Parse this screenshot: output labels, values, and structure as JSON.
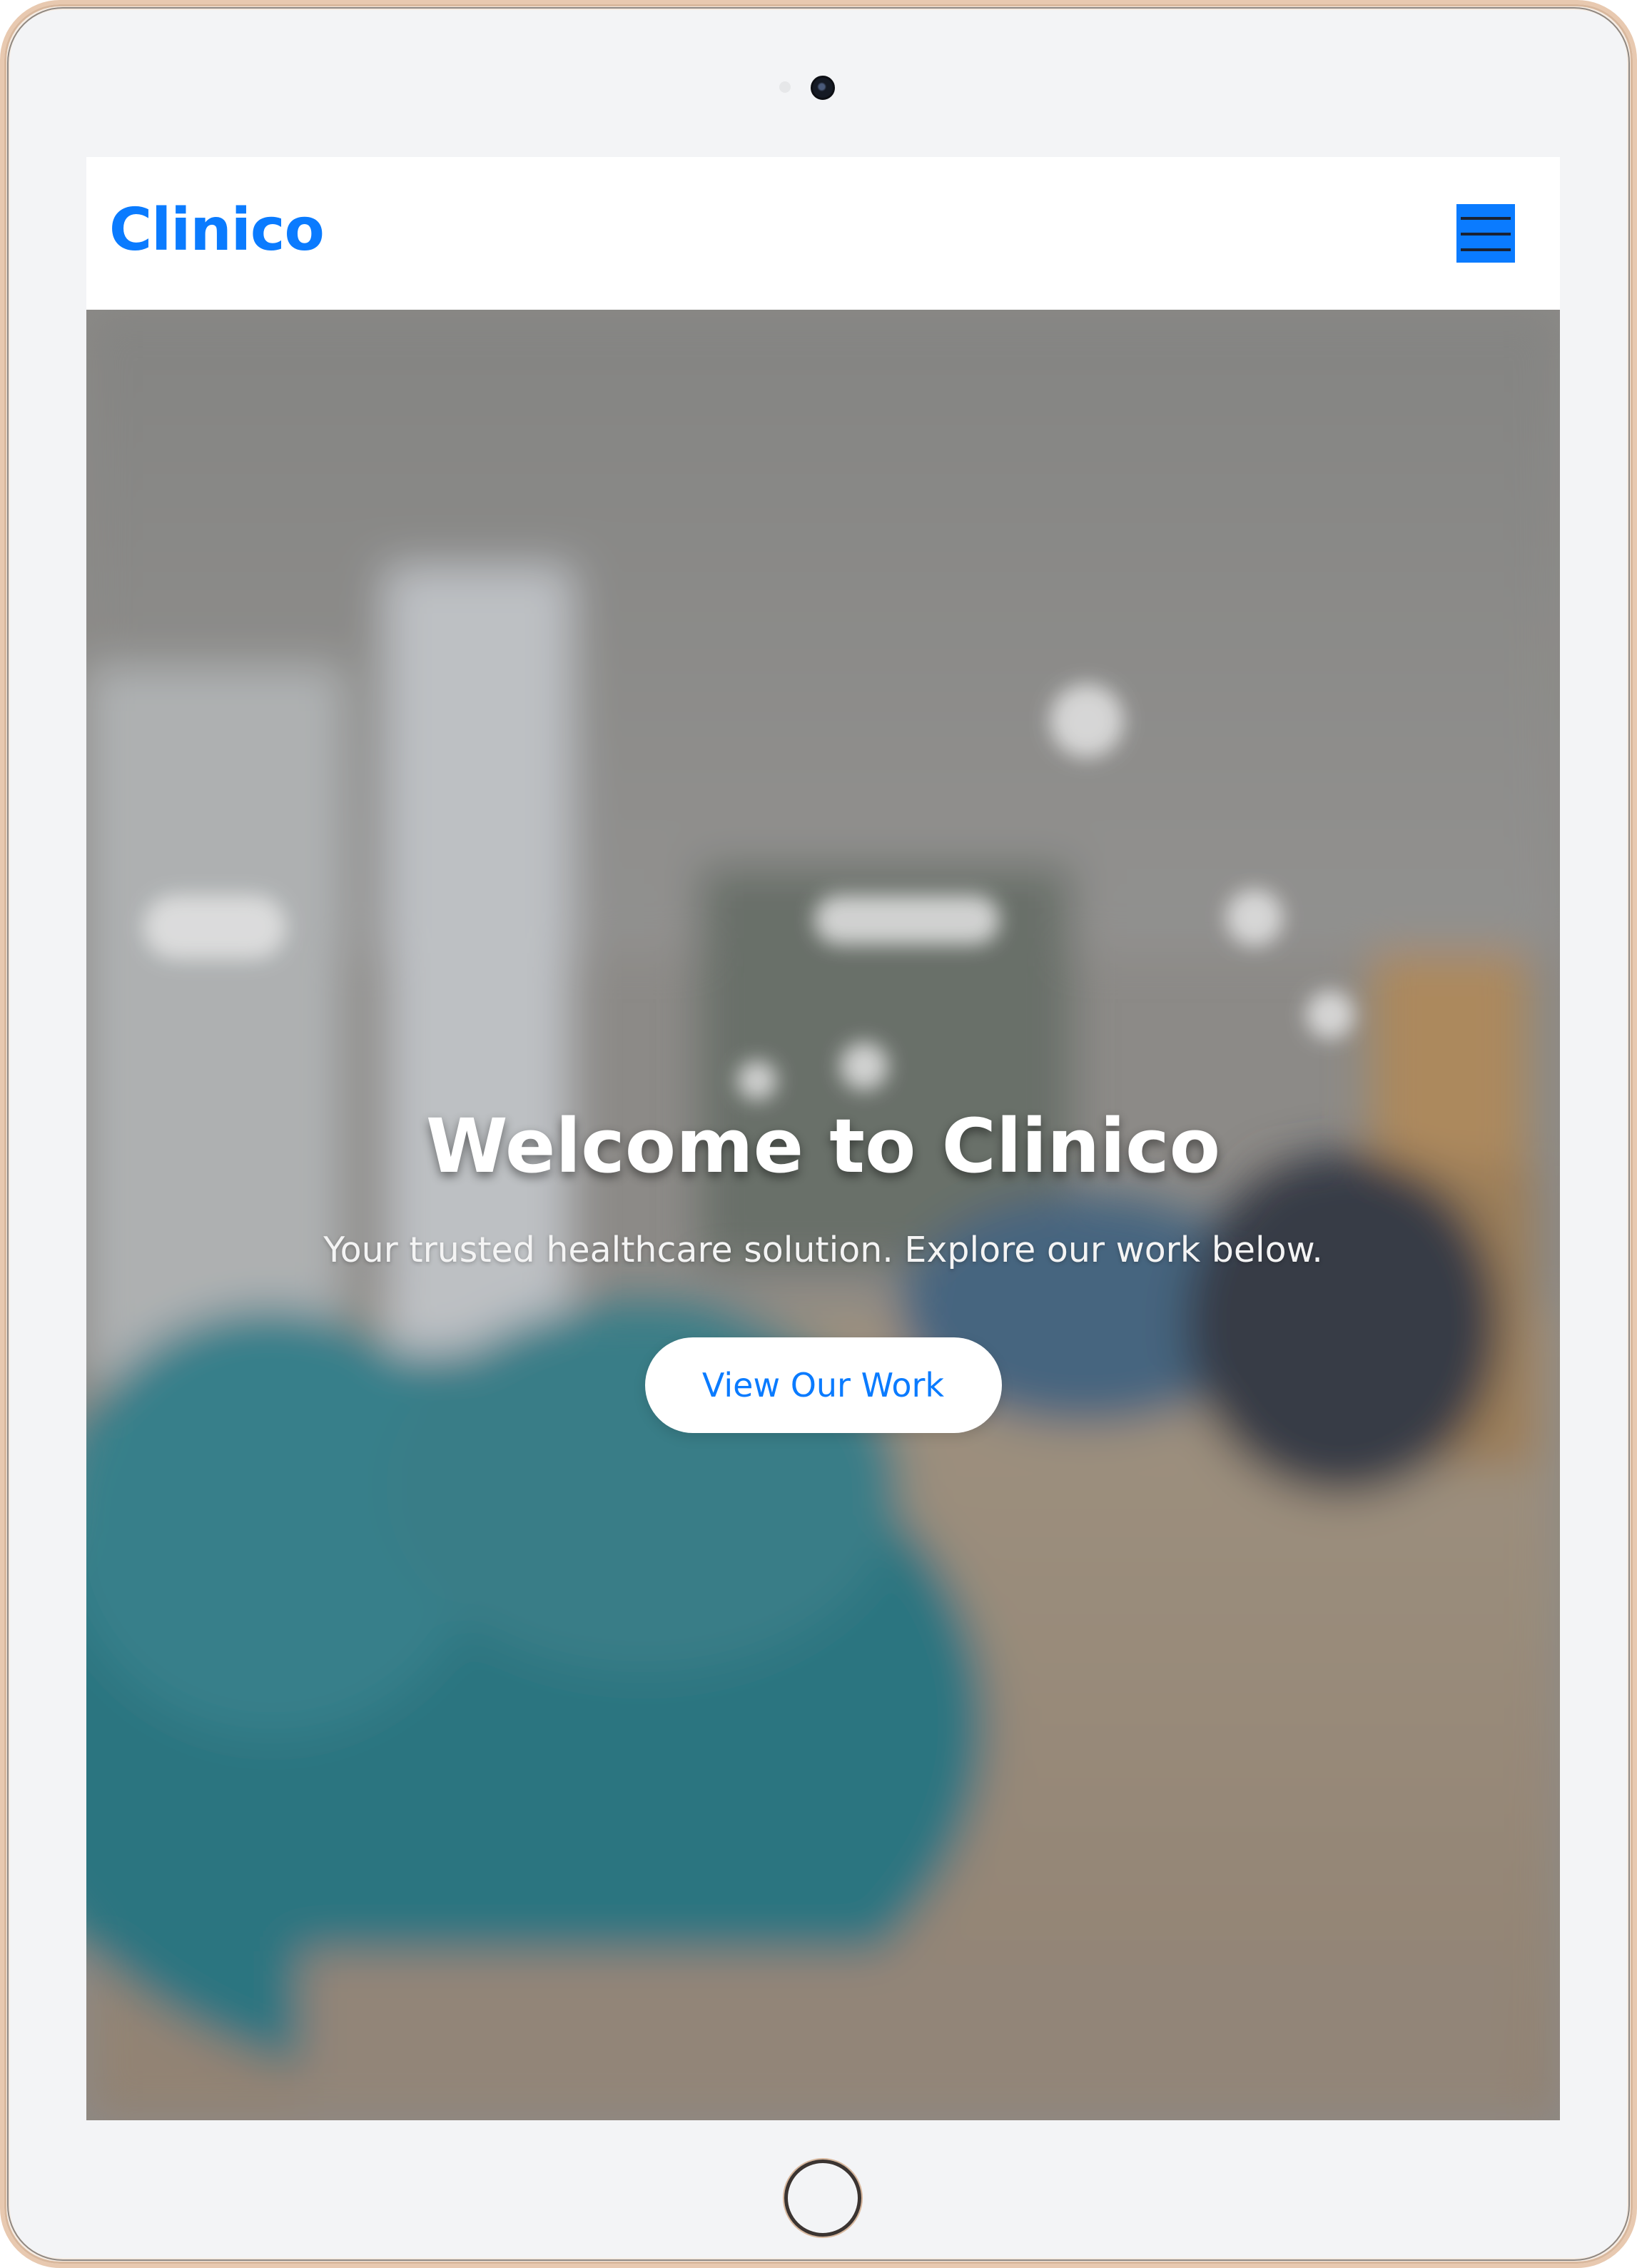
{
  "header": {
    "brand": "Clinico",
    "menu_icon": "hamburger-icon"
  },
  "hero": {
    "title": "Welcome to Clinico",
    "subtitle": "Your trusted healthcare solution. Explore our work below.",
    "cta_label": "View Our Work"
  },
  "colors": {
    "brand": "#0a7bff",
    "screen_bg": "#f3f4f6",
    "hero_text": "#ffffff"
  }
}
